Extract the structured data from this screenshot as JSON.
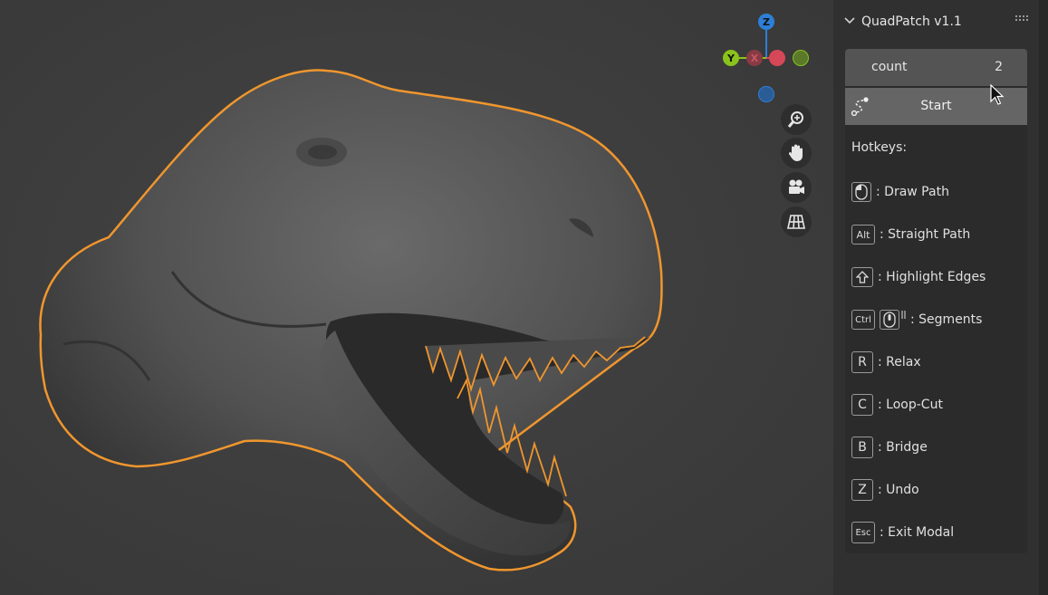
{
  "viewport": {
    "gizmo": {
      "z_label": "Z",
      "y_label": "Y",
      "x_label": "X",
      "colors": {
        "z": "#2d7fd6",
        "y": "#8bc21c",
        "x": "#d64757",
        "neg_y": "#5a7a2a",
        "neg_z": "#2a5c95"
      }
    },
    "nav_icons": [
      "zoom-icon",
      "hand-pan-icon",
      "camera-icon",
      "perspective-grid-icon"
    ],
    "selection_outline_color": "#f0962e"
  },
  "panel": {
    "title": "QuadPatch v1.1",
    "count_label": "count",
    "count_value": "2",
    "start_label": "Start",
    "hotkeys_title": "Hotkeys:",
    "hotkeys": [
      {
        "key": "",
        "key_icon": "mouse-left-icon",
        "action": ": Draw Path"
      },
      {
        "key": "Alt",
        "action": ": Straight Path"
      },
      {
        "key": "",
        "key_icon": "shift-arrow-icon",
        "action": ": Highlight Edges"
      },
      {
        "key": "Ctrl",
        "key_icon": "mouse-scroll-icon",
        "action": ": Segments"
      },
      {
        "key": "R",
        "action": ": Relax"
      },
      {
        "key": "C",
        "action": ": Loop-Cut"
      },
      {
        "key": "B",
        "action": ": Bridge"
      },
      {
        "key": "Z",
        "action": ": Undo"
      },
      {
        "key": "Esc",
        "action": ": Exit Modal"
      }
    ]
  }
}
